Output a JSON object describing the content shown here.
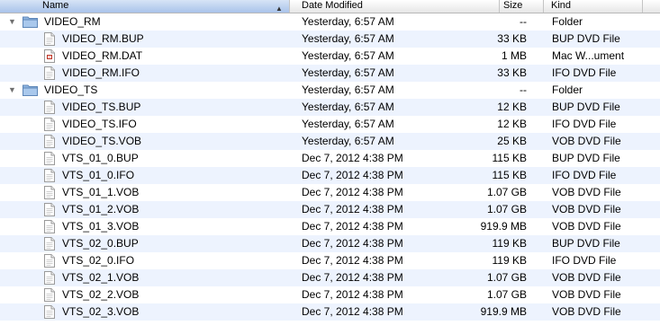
{
  "columns": {
    "name": "Name",
    "date": "Date Modified",
    "size": "Size",
    "kind": "Kind"
  },
  "sort_indicator_icon": "sort-ascending-icon",
  "rows": [
    {
      "type": "folder",
      "icon": "folder-icon",
      "expanded": true,
      "name": "VIDEO_RM",
      "date": "Yesterday, 6:57 AM",
      "size": "--",
      "kind": "Folder"
    },
    {
      "type": "doc",
      "icon": "document-icon",
      "name": "VIDEO_RM.BUP",
      "date": "Yesterday, 6:57 AM",
      "size": "33 KB",
      "kind": "BUP DVD File"
    },
    {
      "type": "doc",
      "icon": "mac-document-icon",
      "name": "VIDEO_RM.DAT",
      "date": "Yesterday, 6:57 AM",
      "size": "1 MB",
      "kind": "Mac W...ument"
    },
    {
      "type": "doc",
      "icon": "document-icon",
      "name": "VIDEO_RM.IFO",
      "date": "Yesterday, 6:57 AM",
      "size": "33 KB",
      "kind": "IFO DVD File"
    },
    {
      "type": "folder",
      "icon": "folder-icon",
      "expanded": true,
      "name": "VIDEO_TS",
      "date": "Yesterday, 6:57 AM",
      "size": "--",
      "kind": "Folder"
    },
    {
      "type": "doc",
      "icon": "document-icon",
      "name": "VIDEO_TS.BUP",
      "date": "Yesterday, 6:57 AM",
      "size": "12 KB",
      "kind": "BUP DVD File"
    },
    {
      "type": "doc",
      "icon": "document-icon",
      "name": "VIDEO_TS.IFO",
      "date": "Yesterday, 6:57 AM",
      "size": "12 KB",
      "kind": "IFO DVD File"
    },
    {
      "type": "doc",
      "icon": "document-icon",
      "name": "VIDEO_TS.VOB",
      "date": "Yesterday, 6:57 AM",
      "size": "25 KB",
      "kind": "VOB DVD File"
    },
    {
      "type": "doc",
      "icon": "document-icon",
      "name": "VTS_01_0.BUP",
      "date": "Dec 7, 2012 4:38 PM",
      "size": "115 KB",
      "kind": "BUP DVD File"
    },
    {
      "type": "doc",
      "icon": "document-icon",
      "name": "VTS_01_0.IFO",
      "date": "Dec 7, 2012 4:38 PM",
      "size": "115 KB",
      "kind": "IFO DVD File"
    },
    {
      "type": "doc",
      "icon": "document-icon",
      "name": "VTS_01_1.VOB",
      "date": "Dec 7, 2012 4:38 PM",
      "size": "1.07 GB",
      "kind": "VOB DVD File"
    },
    {
      "type": "doc",
      "icon": "document-icon",
      "name": "VTS_01_2.VOB",
      "date": "Dec 7, 2012 4:38 PM",
      "size": "1.07 GB",
      "kind": "VOB DVD File"
    },
    {
      "type": "doc",
      "icon": "document-icon",
      "name": "VTS_01_3.VOB",
      "date": "Dec 7, 2012 4:38 PM",
      "size": "919.9 MB",
      "kind": "VOB DVD File"
    },
    {
      "type": "doc",
      "icon": "document-icon",
      "name": "VTS_02_0.BUP",
      "date": "Dec 7, 2012 4:38 PM",
      "size": "119 KB",
      "kind": "BUP DVD File"
    },
    {
      "type": "doc",
      "icon": "document-icon",
      "name": "VTS_02_0.IFO",
      "date": "Dec 7, 2012 4:38 PM",
      "size": "119 KB",
      "kind": "IFO DVD File"
    },
    {
      "type": "doc",
      "icon": "document-icon",
      "name": "VTS_02_1.VOB",
      "date": "Dec 7, 2012 4:38 PM",
      "size": "1.07 GB",
      "kind": "VOB DVD File"
    },
    {
      "type": "doc",
      "icon": "document-icon",
      "name": "VTS_02_2.VOB",
      "date": "Dec 7, 2012 4:38 PM",
      "size": "1.07 GB",
      "kind": "VOB DVD File"
    },
    {
      "type": "doc",
      "icon": "document-icon",
      "name": "VTS_02_3.VOB",
      "date": "Dec 7, 2012 4:38 PM",
      "size": "919.9 MB",
      "kind": "VOB DVD File"
    }
  ],
  "colors": {
    "stripe": "#edf3fe",
    "header_selected": "#a9c3ea",
    "folder_blue": "#7fa7d6",
    "disclosure": "#6f6f6f"
  }
}
